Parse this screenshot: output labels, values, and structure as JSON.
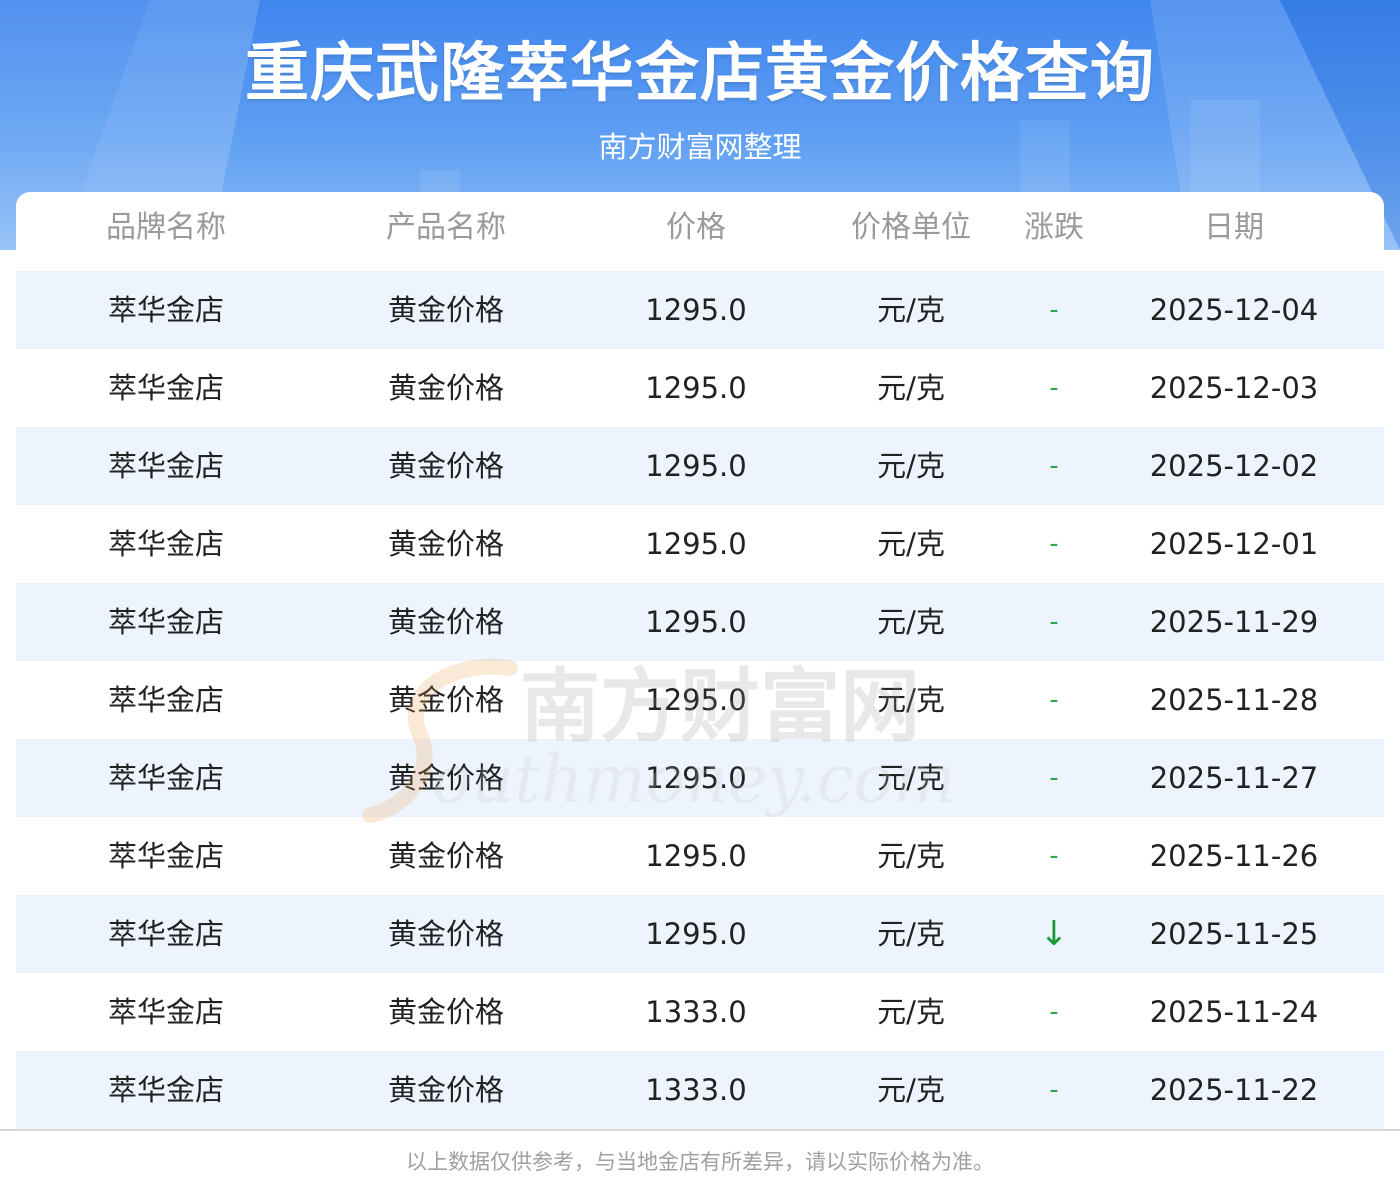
{
  "header": {
    "title": "重庆武隆萃华金店黄金价格查询",
    "subtitle": "南方财富网整理"
  },
  "table": {
    "columns": [
      "品牌名称",
      "产品名称",
      "价格",
      "价格单位",
      "涨跌",
      "日期"
    ],
    "rows": [
      {
        "brand": "萃华金店",
        "product": "黄金价格",
        "price": "1295.0",
        "unit": "元/克",
        "change": "-",
        "date": "2025-12-04"
      },
      {
        "brand": "萃华金店",
        "product": "黄金价格",
        "price": "1295.0",
        "unit": "元/克",
        "change": "-",
        "date": "2025-12-03"
      },
      {
        "brand": "萃华金店",
        "product": "黄金价格",
        "price": "1295.0",
        "unit": "元/克",
        "change": "-",
        "date": "2025-12-02"
      },
      {
        "brand": "萃华金店",
        "product": "黄金价格",
        "price": "1295.0",
        "unit": "元/克",
        "change": "-",
        "date": "2025-12-01"
      },
      {
        "brand": "萃华金店",
        "product": "黄金价格",
        "price": "1295.0",
        "unit": "元/克",
        "change": "-",
        "date": "2025-11-29"
      },
      {
        "brand": "萃华金店",
        "product": "黄金价格",
        "price": "1295.0",
        "unit": "元/克",
        "change": "-",
        "date": "2025-11-28"
      },
      {
        "brand": "萃华金店",
        "product": "黄金价格",
        "price": "1295.0",
        "unit": "元/克",
        "change": "-",
        "date": "2025-11-27"
      },
      {
        "brand": "萃华金店",
        "product": "黄金价格",
        "price": "1295.0",
        "unit": "元/克",
        "change": "-",
        "date": "2025-11-26"
      },
      {
        "brand": "萃华金店",
        "product": "黄金价格",
        "price": "1295.0",
        "unit": "元/克",
        "change": "↓",
        "date": "2025-11-25"
      },
      {
        "brand": "萃华金店",
        "product": "黄金价格",
        "price": "1333.0",
        "unit": "元/克",
        "change": "-",
        "date": "2025-11-24"
      },
      {
        "brand": "萃华金店",
        "product": "黄金价格",
        "price": "1333.0",
        "unit": "元/克",
        "change": "-",
        "date": "2025-11-22"
      }
    ]
  },
  "watermark": {
    "cn": "南方财富网",
    "en": "outhmoney.com"
  },
  "footer": {
    "note": "以上数据仅供参考，与当地金店有所差异，请以实际价格为准。"
  },
  "colors": {
    "header_blue": "#3f86ee",
    "row_alt": "#eef4fe",
    "trend_green": "#2ea84a"
  }
}
